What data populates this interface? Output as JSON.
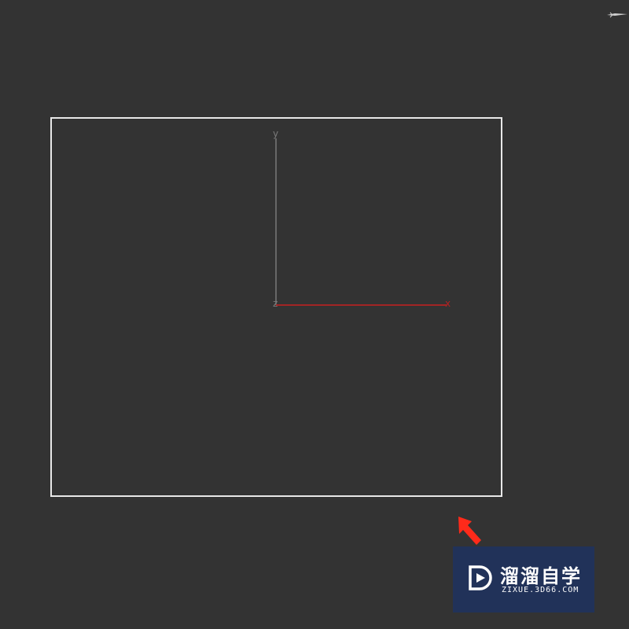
{
  "viewport": {
    "background_color": "#333333",
    "shape": {
      "type": "rectangle",
      "stroke_color": "#e8e8e8"
    },
    "gizmo": {
      "y_label": "y",
      "x_label": "x",
      "z_label": "z",
      "y_axis_color": "#7a7a7a",
      "x_axis_color": "#b22222"
    },
    "cursor_icon": "scale-tool-cursor-icon"
  },
  "annotation": {
    "arrow_color": "#ff2a1a",
    "arrow_icon": "red-arrow-icon"
  },
  "watermark": {
    "title": "溜溜自学",
    "subtitle": "ZIXUE.3D66.COM",
    "logo_icon": "play-logo-icon",
    "background_color": "#20325c"
  }
}
